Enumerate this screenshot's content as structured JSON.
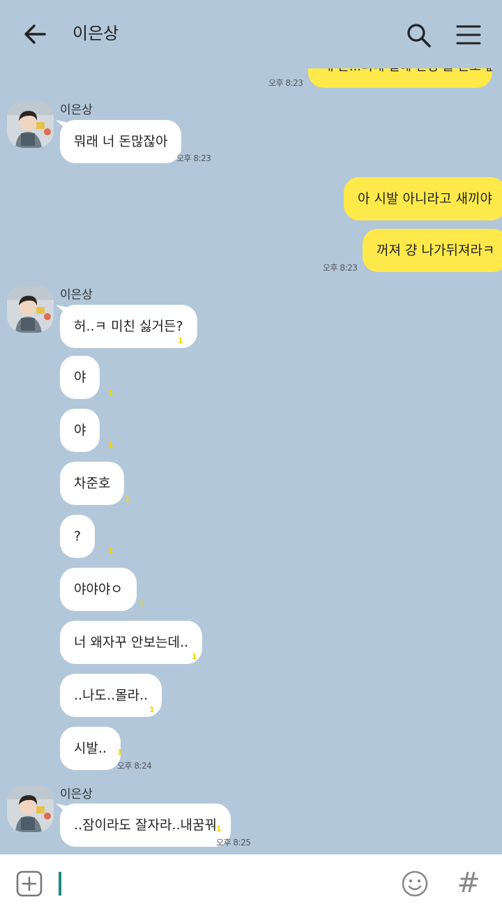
{
  "header": {
    "title": "이은상",
    "back_icon": "arrow-left-icon",
    "search_icon": "search-icon",
    "menu_icon": "menu-icon"
  },
  "sender_name": "이은상",
  "unread_mark": "1",
  "messages": {
    "m0": {
      "text": "내 돈...너네 일에 신경 쓸 돈도 없거든",
      "time": "오후 8:23"
    },
    "m1": {
      "text": "뭐래 너 돈많잖아",
      "time": "오후 8:23"
    },
    "m2": {
      "text": "아 시발 아니라고 새끼야"
    },
    "m3": {
      "text": "꺼져 걍 나가뒤져라ㅋ",
      "time": "오후 8:23"
    },
    "m4": {
      "text": "허..ㅋ 미친 싫거든?"
    },
    "m5": {
      "text": "야"
    },
    "m6": {
      "text": "야"
    },
    "m7": {
      "text": "차준호"
    },
    "m8": {
      "text": "?"
    },
    "m9": {
      "text": "야야야ㅇ"
    },
    "m10": {
      "text": "너 왜자꾸 안보는데.."
    },
    "m11": {
      "text": "..나도..몰라.."
    },
    "m12": {
      "text": "시발..",
      "time": "오후 8:24"
    },
    "m13": {
      "text": "..잠이라도 잘자라..내꿈꿔",
      "time": "오후 8:25"
    }
  },
  "colors": {
    "background": "#b2c7da",
    "my_bubble": "#fee94a",
    "their_bubble": "#ffffff",
    "cursor": "#1f8a7f"
  },
  "input": {
    "plus_icon": "plus-square-icon",
    "emoji_icon": "smile-icon",
    "hash_label": "#"
  }
}
